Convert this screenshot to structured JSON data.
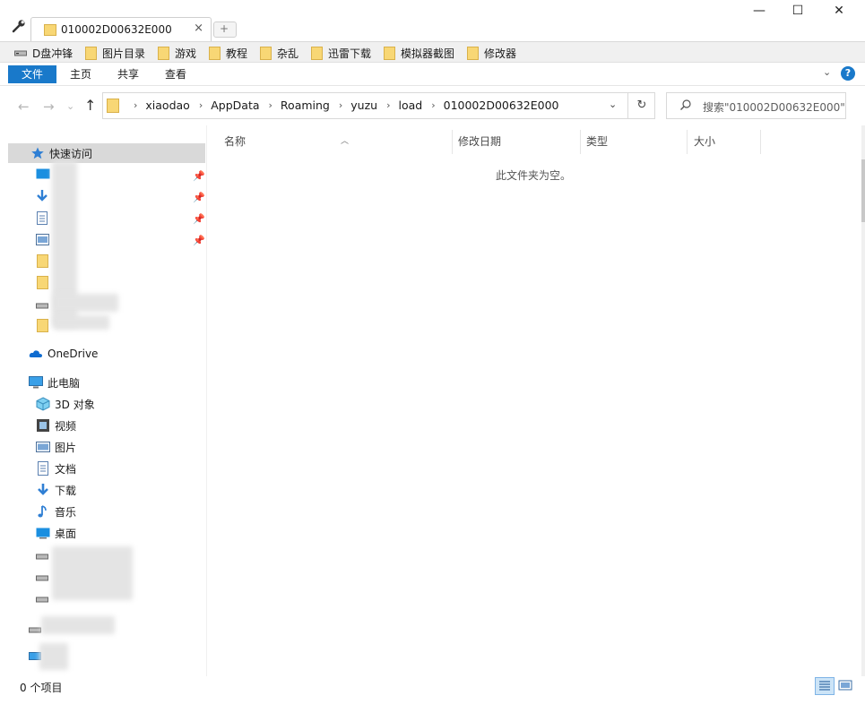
{
  "tab": {
    "title": "010002D00632E000",
    "close": "×",
    "new_tab": "+"
  },
  "window": {
    "minimize": "—",
    "maximize": "☐",
    "close": "✕"
  },
  "bookmarks": [
    {
      "label": "D盘冲锋",
      "icon": "drive-icon"
    },
    {
      "label": "图片目录",
      "icon": "folder-icon"
    },
    {
      "label": "游戏",
      "icon": "folder-icon"
    },
    {
      "label": "教程",
      "icon": "folder-icon"
    },
    {
      "label": "杂乱",
      "icon": "folder-icon"
    },
    {
      "label": "迅雷下载",
      "icon": "folder-icon"
    },
    {
      "label": "模拟器截图",
      "icon": "folder-icon"
    },
    {
      "label": "修改器",
      "icon": "folder-icon"
    }
  ],
  "ribbon": {
    "tabs": [
      "文件",
      "主页",
      "共享",
      "查看"
    ],
    "expand": "⌄",
    "help": "?"
  },
  "nav": {
    "back": "←",
    "forward": "→",
    "recent": "⌄",
    "up": "↑"
  },
  "address": {
    "crumbs": [
      "xiaodao",
      "AppData",
      "Roaming",
      "yuzu",
      "load",
      "010002D00632E000"
    ],
    "dropdown": "⌄",
    "refresh": "↻"
  },
  "search": {
    "placeholder": "搜索\"010002D00632E000\""
  },
  "navpane": {
    "quick_access": "快速访问",
    "onedrive": "OneDrive",
    "this_pc": "此电脑",
    "pc_items": [
      "3D 对象",
      "视频",
      "图片",
      "文档",
      "下载",
      "音乐",
      "桌面"
    ]
  },
  "columns": [
    "名称",
    "修改日期",
    "类型",
    "大小"
  ],
  "content": {
    "empty_message": "此文件夹为空。"
  },
  "status": {
    "item_count": "0 个项目"
  },
  "colors": {
    "accent": "#1979ca",
    "folder": "#f8d775",
    "selected": "#d9d9d9"
  }
}
